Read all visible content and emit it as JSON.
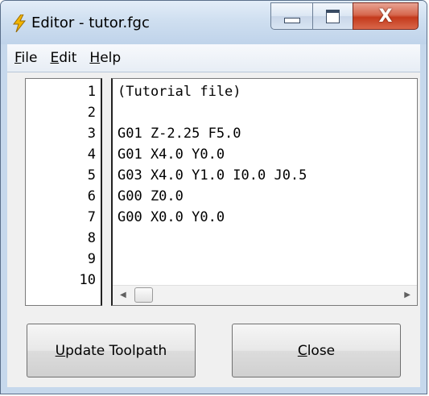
{
  "window": {
    "title": "Editor - tutor.fgc",
    "caption_buttons": [
      "minimize",
      "maximize",
      "close"
    ],
    "close_glyph": "X"
  },
  "menu": [
    {
      "accel": "F",
      "rest": "ile"
    },
    {
      "accel": "E",
      "rest": "dit"
    },
    {
      "accel": "H",
      "rest": "elp"
    }
  ],
  "editor": {
    "line_numbers": [
      "1",
      "2",
      "3",
      "4",
      "5",
      "6",
      "7",
      "8",
      "9",
      "10"
    ],
    "lines": [
      "(Tutorial file)",
      "",
      "G01 Z-2.25 F5.0",
      "G01 X4.0 Y0.0",
      "G03 X4.0 Y1.0 I0.0 J0.5",
      "G00 Z0.0",
      "G00 X0.0 Y0.0",
      "",
      "",
      ""
    ]
  },
  "buttons": {
    "update": {
      "accel": "U",
      "rest": "pdate Toolpath"
    },
    "close": {
      "accel": "C",
      "rest": "lose"
    }
  },
  "icons": {
    "app": "lightning-icon",
    "scroll_left": "arrow-left-icon",
    "scroll_right": "arrow-right-icon"
  },
  "colors": {
    "title_frame": "#c6d8ec",
    "close_button": "#c43a1c",
    "app_icon": "#f2b400"
  }
}
